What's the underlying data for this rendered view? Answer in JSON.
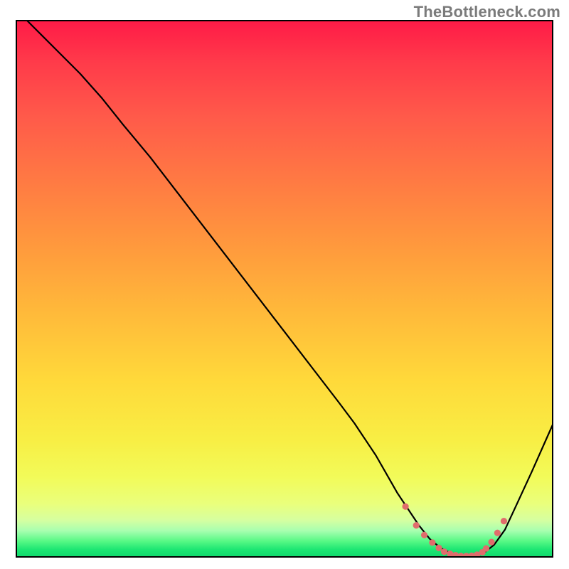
{
  "header": {
    "attribution": "TheBottleneck.com"
  },
  "chart_data": {
    "type": "line",
    "title": "",
    "xlabel": "",
    "ylabel": "",
    "xlim": [
      0,
      100
    ],
    "ylim": [
      0,
      100
    ],
    "grid": false,
    "series": [
      {
        "name": "bottleneck_curve",
        "color": "#000000",
        "x": [
          2,
          5,
          8,
          12,
          16,
          20,
          25,
          30,
          35,
          40,
          45,
          50,
          55,
          60,
          63,
          65,
          67,
          69,
          71,
          73,
          75,
          77,
          79,
          81,
          83,
          85,
          87,
          89,
          91,
          93,
          96,
          100
        ],
        "y": [
          100,
          97,
          94,
          90,
          85.5,
          80.5,
          74.5,
          68,
          61.5,
          55,
          48.5,
          42,
          35.5,
          29,
          25,
          22,
          19,
          15.5,
          12,
          9,
          6,
          3.5,
          1.8,
          0.8,
          0.3,
          0.3,
          0.8,
          2.4,
          5.2,
          9.5,
          16,
          25
        ]
      }
    ],
    "optimal_range": {
      "marker_color": "#e06c6c",
      "marker_radius_px": 4.6,
      "points_x": [
        72.5,
        74.5,
        76,
        77.5,
        78.7,
        79.7,
        80.8,
        81.8,
        82.8,
        83.8,
        84.8,
        85.8,
        86.8,
        87.5,
        88.5,
        89.6,
        90.8
      ],
      "points_y": [
        9.5,
        6.0,
        4.2,
        2.8,
        1.8,
        1.1,
        0.7,
        0.45,
        0.3,
        0.3,
        0.35,
        0.55,
        1.0,
        1.7,
        2.9,
        4.6,
        6.8
      ]
    },
    "background_gradient": {
      "orientation": "vertical",
      "stops": [
        {
          "pos": 0.0,
          "color": "#ff1a47"
        },
        {
          "pos": 0.3,
          "color": "#ff7a43"
        },
        {
          "pos": 0.55,
          "color": "#ffbb3a"
        },
        {
          "pos": 0.78,
          "color": "#f8ee44"
        },
        {
          "pos": 0.9,
          "color": "#eaff7c"
        },
        {
          "pos": 0.97,
          "color": "#55f884"
        },
        {
          "pos": 1.0,
          "color": "#0fd86c"
        }
      ]
    }
  }
}
